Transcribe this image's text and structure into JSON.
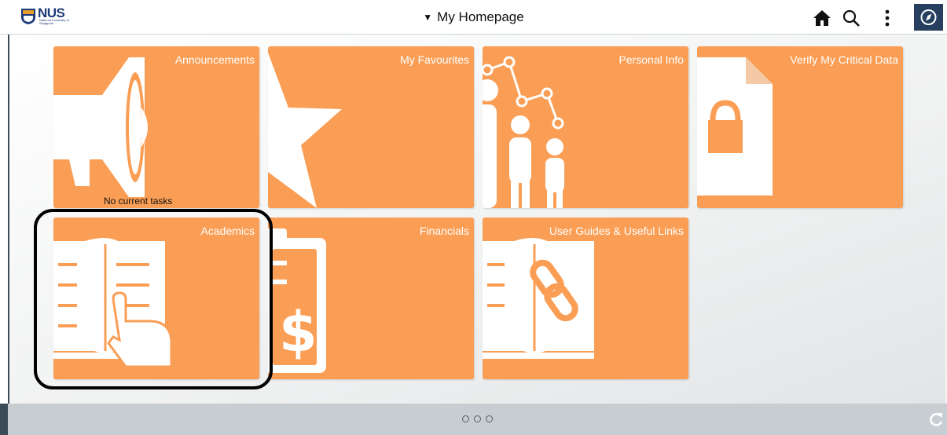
{
  "header": {
    "logo_text": "NUS",
    "logo_subtext": "National University of Singapore",
    "title": "My Homepage",
    "title_caret": "▼"
  },
  "tiles": [
    {
      "title": "Announcements",
      "note": "No current tasks",
      "icon": "megaphone-icon"
    },
    {
      "title": "My Favourites",
      "icon": "star-icon"
    },
    {
      "title": "Personal Info",
      "icon": "people-icon"
    },
    {
      "title": "Verify My Critical Data",
      "icon": "locked-document-icon"
    },
    {
      "title": "Academics",
      "icon": "book-hand-icon"
    },
    {
      "title": "Financials",
      "icon": "clipboard-dollar-icon"
    },
    {
      "title": "User Guides & Useful Links",
      "icon": "book-link-icon"
    }
  ],
  "pager": {
    "pages": 3,
    "current": 1
  },
  "colors": {
    "tile": "#fb9e55",
    "header_nav": "#263f5e",
    "footer": "#c8cdd2"
  }
}
